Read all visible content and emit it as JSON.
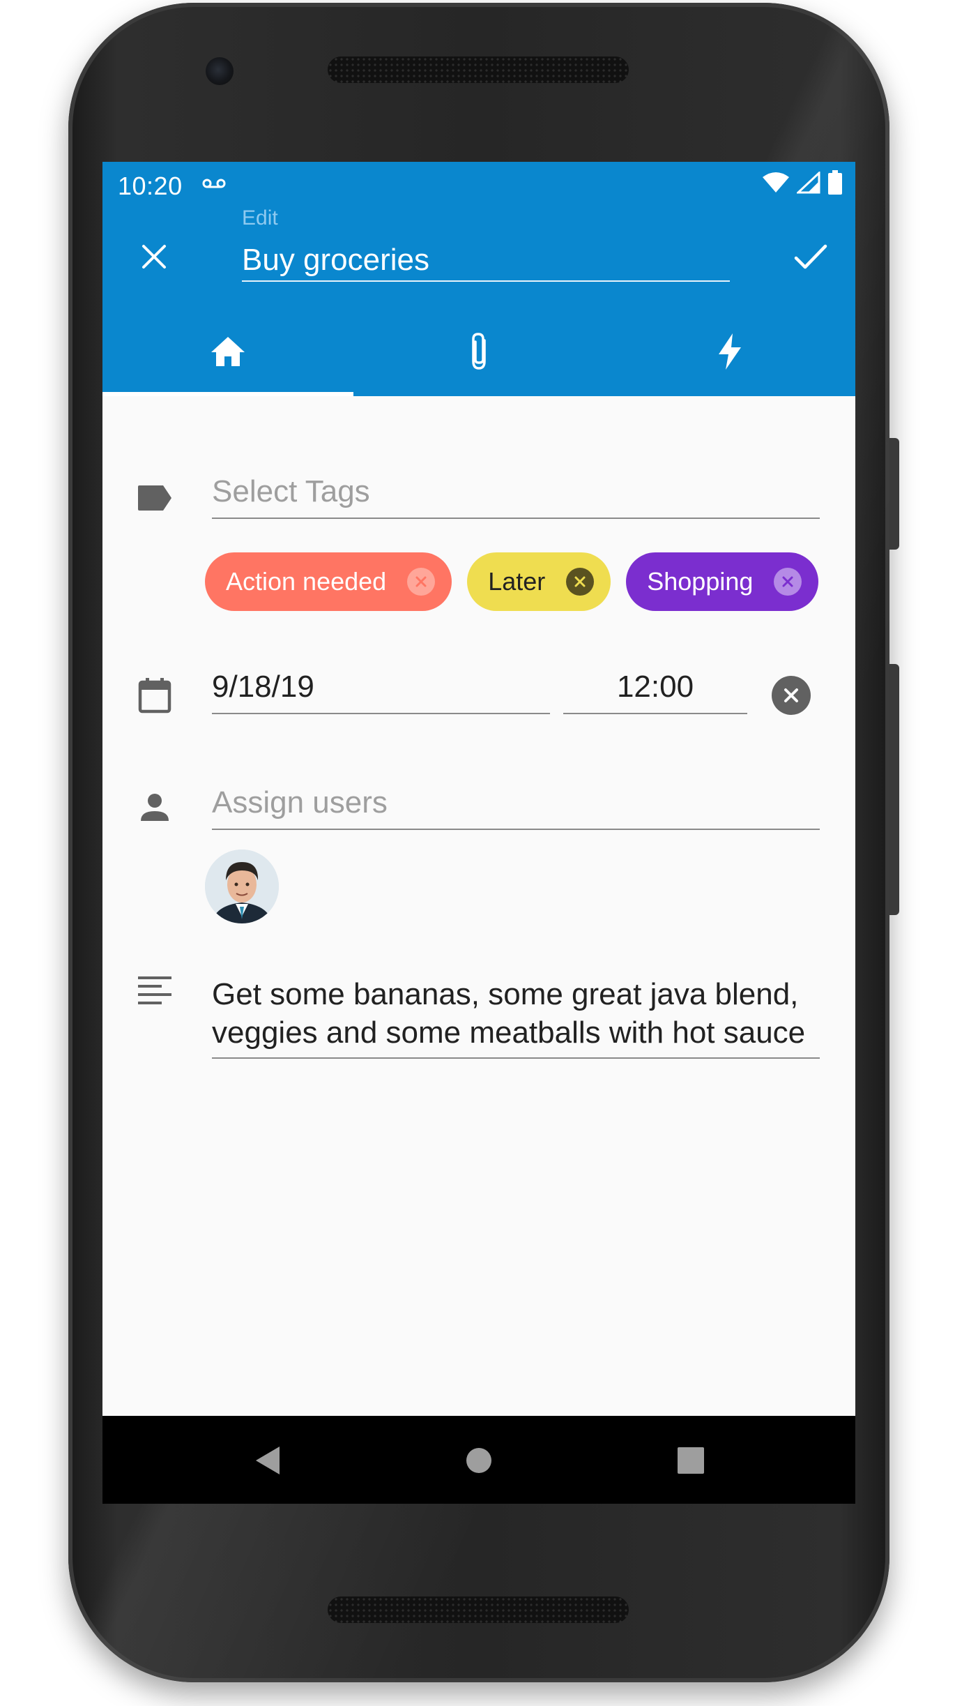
{
  "status_bar": {
    "time": "10:20",
    "voicemail_icon": "voicemail-icon",
    "icons": [
      "wifi-icon",
      "signal-icon",
      "battery-icon"
    ]
  },
  "app_bar": {
    "edit_label": "Edit",
    "title_value": "Buy groceries",
    "close_icon": "close-icon",
    "confirm_icon": "check-icon",
    "background_color": "#0A87CE"
  },
  "tabs": [
    {
      "icon": "home-icon",
      "selected": true
    },
    {
      "icon": "paperclip-icon",
      "selected": false
    },
    {
      "icon": "lightning-icon",
      "selected": false
    }
  ],
  "tags": {
    "icon": "label-icon",
    "placeholder": "Select Tags",
    "chips": [
      {
        "label": "Action needed",
        "color": "#FF7563",
        "text_color": "#ffffff"
      },
      {
        "label": "Later",
        "color": "#EFDD50",
        "text_color": "#222222"
      },
      {
        "label": "Shopping",
        "color": "#7B2ECF",
        "text_color": "#ffffff"
      }
    ]
  },
  "due": {
    "icon": "calendar-icon",
    "date": "9/18/19",
    "time": "12:00",
    "clear_icon": "clear-circle-icon"
  },
  "users": {
    "icon": "person-icon",
    "placeholder": "Assign users",
    "avatars": [
      "avatar"
    ]
  },
  "notes": {
    "icon": "notes-icon",
    "text": "Get some bananas, some great java blend, veggies and some meatballs with hot sauce"
  },
  "nav_bar": [
    "back-icon",
    "home-circle-icon",
    "recents-icon"
  ]
}
